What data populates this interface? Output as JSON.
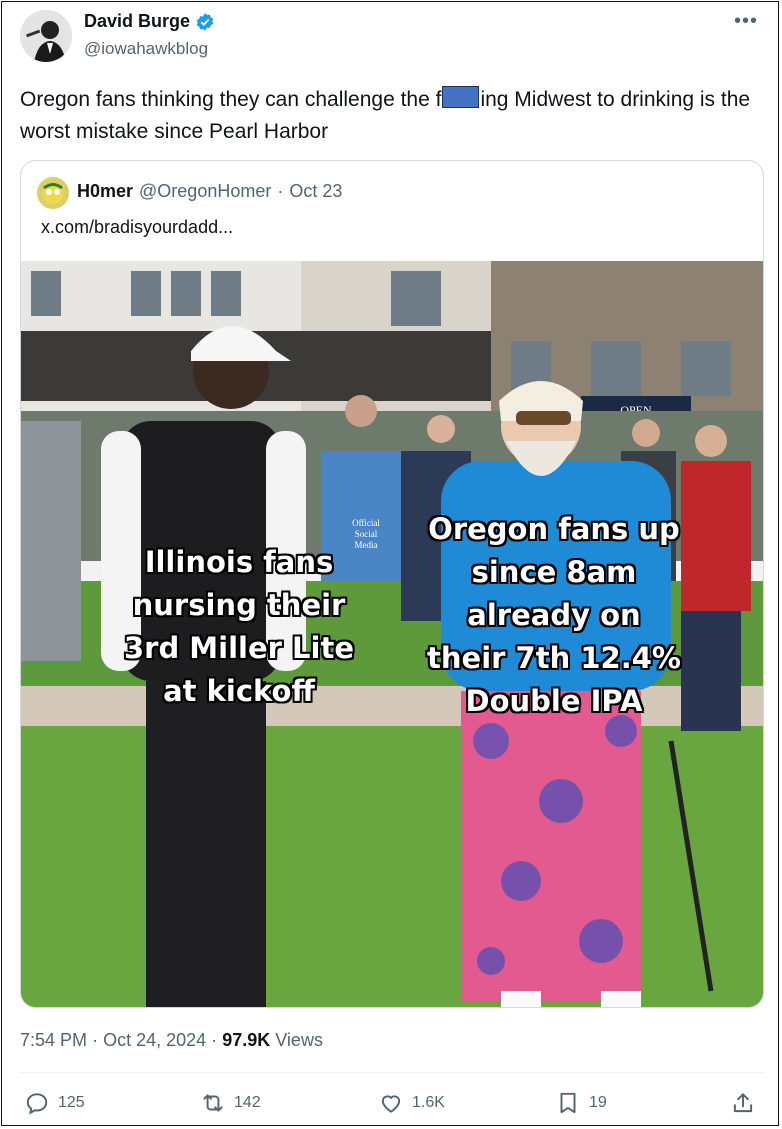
{
  "author": {
    "name": "David Burge",
    "handle": "@iowahawkblog"
  },
  "tweet": {
    "text_before": "Oregon fans thinking they can challenge the f",
    "text_after": "ing Midwest to drinking is the worst mistake since Pearl Harbor"
  },
  "quote": {
    "name": "H0mer",
    "handle": "@OregonHomer",
    "separator": "·",
    "date": "Oct 23",
    "link": "x.com/bradisyourdadd...",
    "meme_left": "Illinois fans\nnursing their\n3rd Miller Lite\nat kickoff",
    "meme_right": "Oregon fans up\nsince 8am\nalready on\ntheir 7th 12.4%\nDouble IPA",
    "banner_sign": "OPEN",
    "vest_text": "Official\nSocial\nMedia"
  },
  "timestamp": {
    "time": "7:54 PM",
    "dot1": "·",
    "date": "Oct 24, 2024",
    "dot2": "·",
    "views": "97.9K",
    "views_label": "Views"
  },
  "actions": {
    "replies": "125",
    "reposts": "142",
    "likes": "1.6K",
    "bookmarks": "19"
  },
  "colors": {
    "accent": "#1d9bf0",
    "muted": "#536471",
    "redaction": "#4472c4"
  },
  "icons": {
    "more": "more-icon",
    "verified": "verified-icon",
    "reply": "reply-icon",
    "repost": "repost-icon",
    "like": "like-icon",
    "bookmark": "bookmark-icon",
    "share": "share-icon"
  }
}
